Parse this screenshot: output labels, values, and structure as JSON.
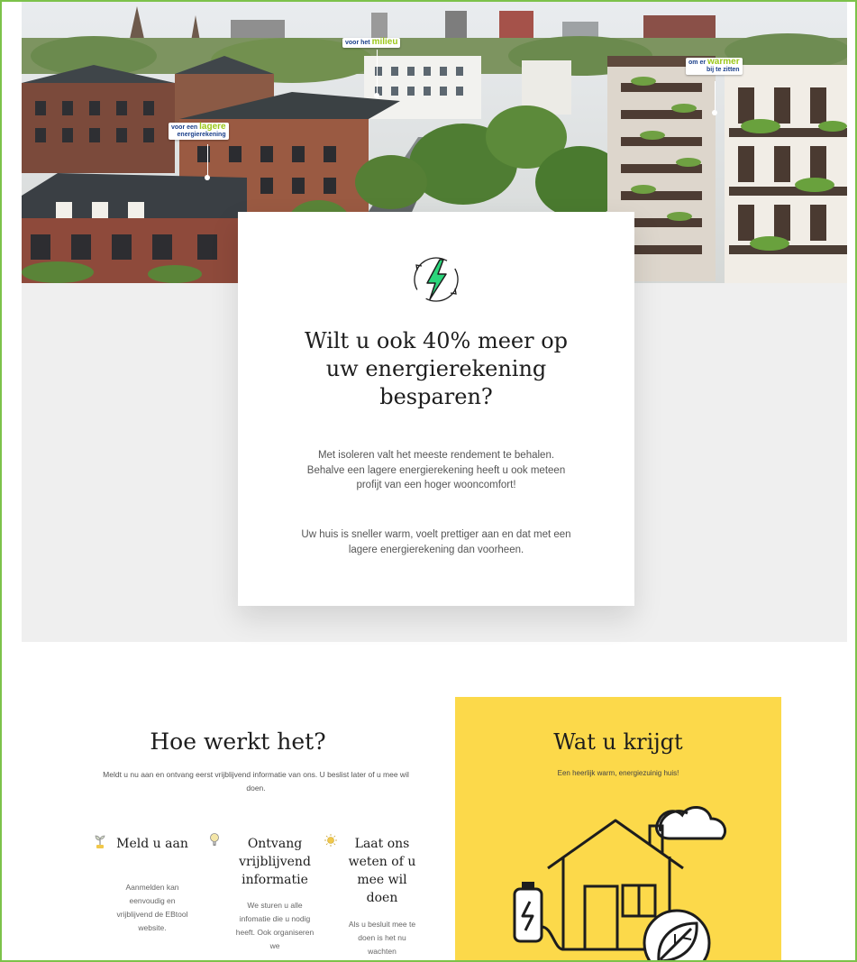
{
  "hero": {
    "tags": [
      {
        "pre": "voor het",
        "accent": "milieu",
        "post": ""
      },
      {
        "pre": "om er",
        "accent": "warmer",
        "post": "bij te zitten"
      },
      {
        "pre": "voor een",
        "accent": "lagere",
        "post": "energierekening"
      }
    ]
  },
  "intro": {
    "icon": "energy-refresh-icon",
    "title": "Wilt u ook 40% meer op uw energierekening besparen?",
    "paragraph1": "Met isoleren valt het meeste rendement te behalen. Behalve een lagere energierekening heeft u ook meteen profijt van een hoger wooncomfort!",
    "paragraph2": "Uw huis is sneller warm, voelt prettiger aan en dat met een lagere energierekening dan voorheen."
  },
  "how": {
    "title": "Hoe werkt het?",
    "subtitle": "Meldt u nu aan en ontvang eerst vrijblijvend informatie van ons. U beslist later of u mee wil doen.",
    "steps": [
      {
        "icon": "plant-icon",
        "title": "Meld u aan",
        "text": "Aanmelden kan eenvoudig en vrijblijvend de EBtool website."
      },
      {
        "icon": "lightbulb-icon",
        "title": "Ontvang vrijblijvend informatie",
        "text": "We sturen u alle infomatie die u nodig heeft. Ook organiseren we"
      },
      {
        "icon": "sun-icon",
        "title": "Laat ons weten of u mee wil doen",
        "text": "Als u besluit mee te doen is het nu wachten"
      }
    ]
  },
  "benefits": {
    "title": "Wat u krijgt",
    "subtitle": "Een heerlijk warm, energiezuinig huis!",
    "illustration": "house-battery-leaf-cloud-icon",
    "background": "#fcd94a"
  },
  "colors": {
    "frame": "#7cc24a",
    "accent_green": "#2bd67b",
    "yellow": "#fcd94a"
  }
}
